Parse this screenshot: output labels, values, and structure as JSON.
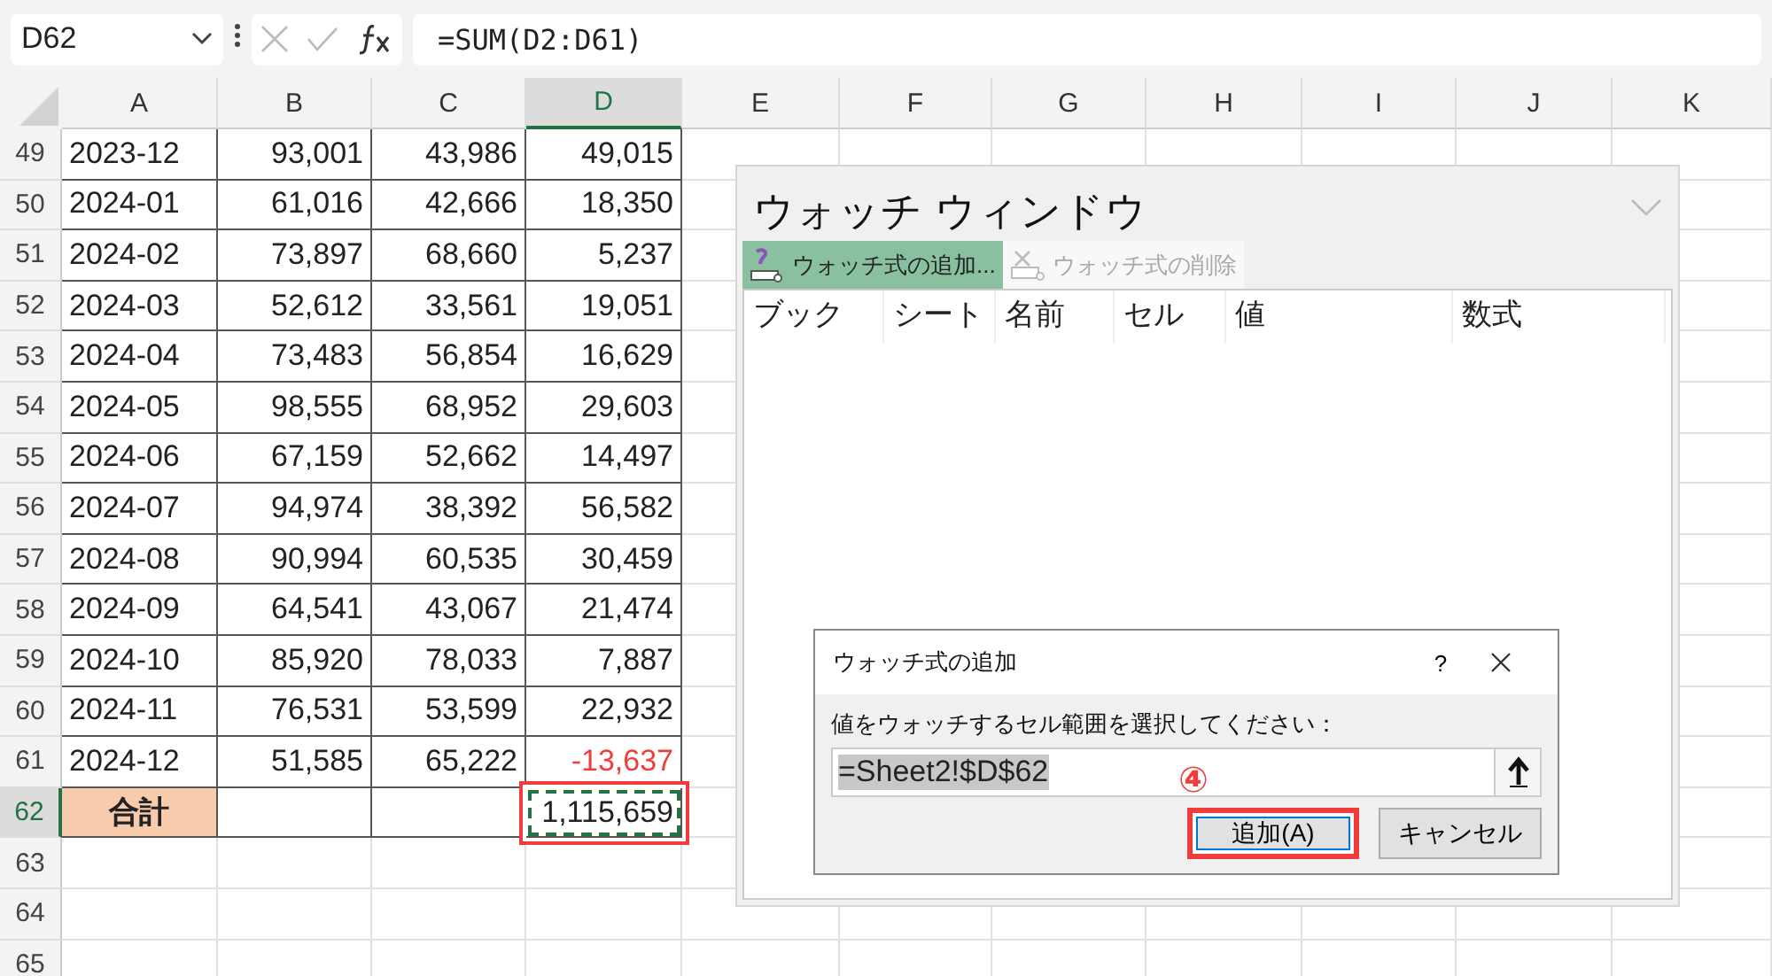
{
  "formula_bar": {
    "name_box": "D62",
    "formula": "=SUM(D2:D61)"
  },
  "columns": [
    {
      "label": "A",
      "selected": false
    },
    {
      "label": "B",
      "selected": false
    },
    {
      "label": "C",
      "selected": false
    },
    {
      "label": "D",
      "selected": true
    },
    {
      "label": "E",
      "selected": false
    },
    {
      "label": "F",
      "selected": false
    },
    {
      "label": "G",
      "selected": false
    },
    {
      "label": "H",
      "selected": false
    },
    {
      "label": "I",
      "selected": false
    },
    {
      "label": "J",
      "selected": false
    },
    {
      "label": "K",
      "selected": false
    }
  ],
  "rows": [
    {
      "number": "49",
      "kind": "data",
      "selected": false,
      "negative": false,
      "cells": [
        "2023-12",
        "93,001",
        "43,986",
        "49,015"
      ]
    },
    {
      "number": "50",
      "kind": "data",
      "selected": false,
      "negative": false,
      "cells": [
        "2024-01",
        "61,016",
        "42,666",
        "18,350"
      ]
    },
    {
      "number": "51",
      "kind": "data",
      "selected": false,
      "negative": false,
      "cells": [
        "2024-02",
        "73,897",
        "68,660",
        "5,237"
      ]
    },
    {
      "number": "52",
      "kind": "data",
      "selected": false,
      "negative": false,
      "cells": [
        "2024-03",
        "52,612",
        "33,561",
        "19,051"
      ]
    },
    {
      "number": "53",
      "kind": "data",
      "selected": false,
      "negative": false,
      "cells": [
        "2024-04",
        "73,483",
        "56,854",
        "16,629"
      ]
    },
    {
      "number": "54",
      "kind": "data",
      "selected": false,
      "negative": false,
      "cells": [
        "2024-05",
        "98,555",
        "68,952",
        "29,603"
      ]
    },
    {
      "number": "55",
      "kind": "data",
      "selected": false,
      "negative": false,
      "cells": [
        "2024-06",
        "67,159",
        "52,662",
        "14,497"
      ]
    },
    {
      "number": "56",
      "kind": "data",
      "selected": false,
      "negative": false,
      "cells": [
        "2024-07",
        "94,974",
        "38,392",
        "56,582"
      ]
    },
    {
      "number": "57",
      "kind": "data",
      "selected": false,
      "negative": false,
      "cells": [
        "2024-08",
        "90,994",
        "60,535",
        "30,459"
      ]
    },
    {
      "number": "58",
      "kind": "data",
      "selected": false,
      "negative": false,
      "cells": [
        "2024-09",
        "64,541",
        "43,067",
        "21,474"
      ]
    },
    {
      "number": "59",
      "kind": "data",
      "selected": false,
      "negative": false,
      "cells": [
        "2024-10",
        "85,920",
        "78,033",
        "7,887"
      ]
    },
    {
      "number": "60",
      "kind": "data",
      "selected": false,
      "negative": false,
      "cells": [
        "2024-11",
        "76,531",
        "53,599",
        "22,932"
      ]
    },
    {
      "number": "61",
      "kind": "data",
      "selected": false,
      "negative": true,
      "cells": [
        "2024-12",
        "51,585",
        "65,222",
        "-13,637"
      ]
    },
    {
      "number": "62",
      "kind": "total",
      "selected": true,
      "label": "合計",
      "total": "1,115,659",
      "annotated": true
    },
    {
      "number": "63",
      "kind": "empty",
      "selected": false
    },
    {
      "number": "64",
      "kind": "empty",
      "selected": false
    },
    {
      "number": "65",
      "kind": "empty",
      "selected": false
    }
  ],
  "watch_window": {
    "title": "ウォッチ ウィンドウ",
    "toolbar": [
      {
        "label": "ウォッチ式の追加...",
        "kind": "add",
        "disabled": false,
        "hovered": true
      },
      {
        "label": "ウォッチ式の削除",
        "kind": "delete",
        "disabled": true,
        "hovered": false
      }
    ],
    "columns": [
      "ブック",
      "シート",
      "名前",
      "セル",
      "値",
      "数式"
    ]
  },
  "dialog": {
    "title": "ウォッチ式の追加",
    "help": "?",
    "prompt": "値をウォッチするセル範囲を選択してください：",
    "value": "=Sheet2!$D$62",
    "value_selected": true,
    "step_marker": "④",
    "buttons": [
      {
        "label": "追加(A)",
        "default": true,
        "annotated": true
      },
      {
        "label": "キャンセル",
        "default": false,
        "annotated": false
      }
    ]
  }
}
